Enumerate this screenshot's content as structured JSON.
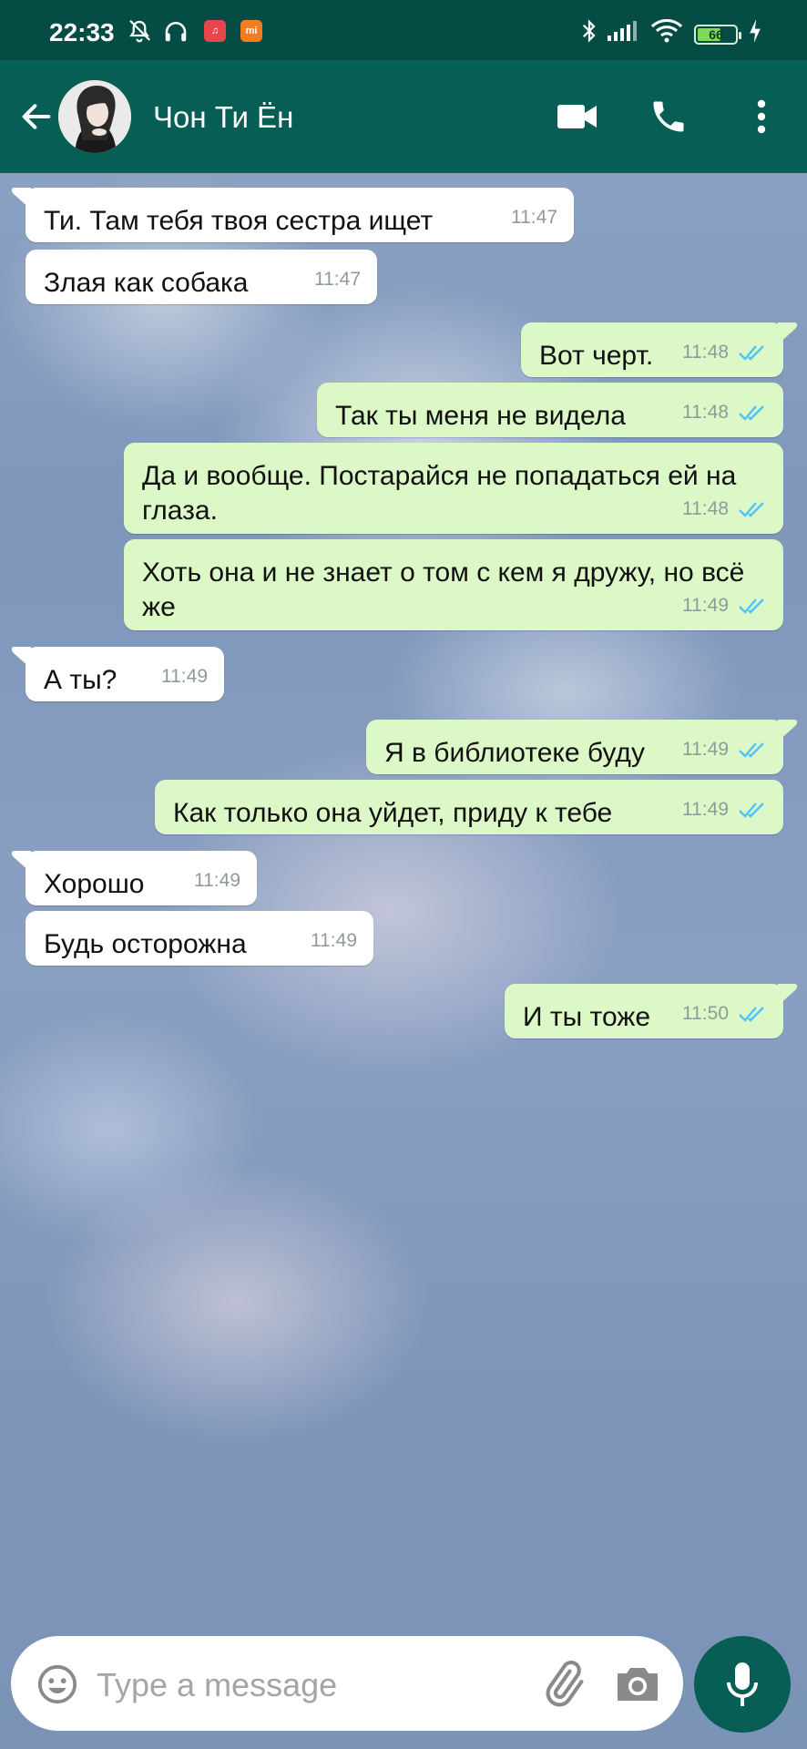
{
  "status_bar": {
    "time": "22:33",
    "battery": "66",
    "battery_level_percent": 66,
    "icons": [
      "mute-alarm-icon",
      "headphones-icon",
      "music-app-icon",
      "mi-app-icon",
      "bluetooth-icon",
      "signal-icon",
      "wifi-icon",
      "battery-icon",
      "charging-icon"
    ],
    "music_badge": "♫",
    "mi_badge": "mi"
  },
  "header": {
    "contact_name": "Чон Ти Ён",
    "icons": [
      "back-arrow-icon",
      "video-call-icon",
      "voice-call-icon",
      "more-options-icon"
    ]
  },
  "messages": [
    {
      "dir": "in",
      "text": "Ти. Там тебя твоя сестра ищет",
      "time": "11:47",
      "tail": true
    },
    {
      "dir": "in",
      "text": "Злая как собака",
      "time": "11:47",
      "tail": false
    },
    {
      "dir": "out",
      "text": "Вот черт.",
      "time": "11:48",
      "ticks": "read",
      "tail": true
    },
    {
      "dir": "out",
      "text": "Так ты меня не видела",
      "time": "11:48",
      "ticks": "read",
      "tail": false
    },
    {
      "dir": "out",
      "text": "Да и вообще. Постарайся не попадаться ей на глаза.",
      "time": "11:48",
      "ticks": "read",
      "tail": false
    },
    {
      "dir": "out",
      "text": "Хоть она и не знает о том с кем я дружу, но всё же",
      "time": "11:49",
      "ticks": "read",
      "tail": false
    },
    {
      "dir": "in",
      "text": "А ты?",
      "time": "11:49",
      "tail": true
    },
    {
      "dir": "out",
      "text": "Я в библиотеке буду",
      "time": "11:49",
      "ticks": "read",
      "tail": true
    },
    {
      "dir": "out",
      "text": "Как только она уйдет, приду к тебе",
      "time": "11:49",
      "ticks": "read",
      "tail": false
    },
    {
      "dir": "in",
      "text": "Хорошо",
      "time": "11:49",
      "tail": true
    },
    {
      "dir": "in",
      "text": "Будь осторожна",
      "time": "11:49",
      "tail": false
    },
    {
      "dir": "out",
      "text": "И ты тоже",
      "time": "11:50",
      "ticks": "read",
      "tail": true
    }
  ],
  "composer": {
    "placeholder": "Type a message",
    "value": "",
    "icons": [
      "emoji-icon",
      "attach-icon",
      "camera-icon",
      "mic-icon"
    ]
  },
  "colors": {
    "header": "#075e54",
    "status_bar": "#054d44",
    "outgoing_bubble": "#dcf8c6",
    "incoming_bubble": "#ffffff",
    "read_ticks": "#4fc3f7",
    "timestamp": "#8f9b98"
  }
}
